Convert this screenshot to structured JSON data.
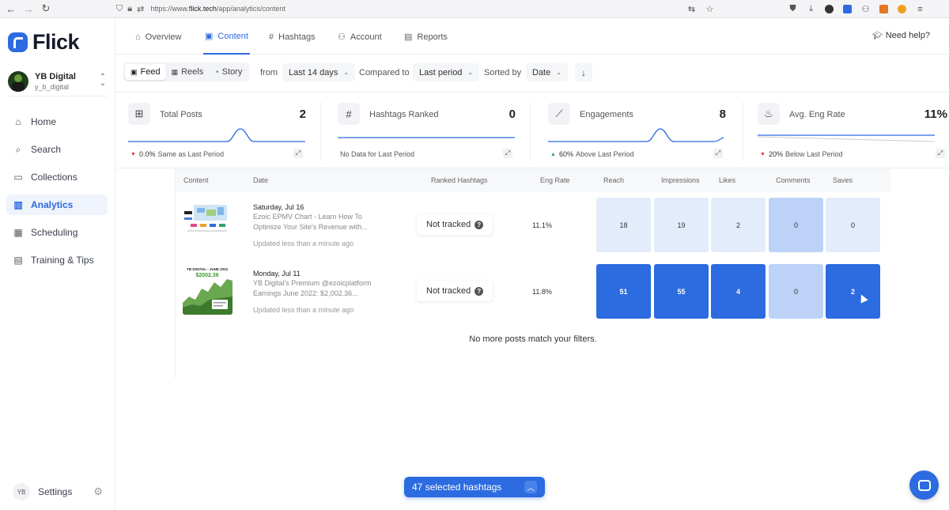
{
  "browser": {
    "url_prefix": "https://www.",
    "url_domain": "flick.tech",
    "url_path": "/app/analytics/content"
  },
  "sidebar": {
    "logo_text": "Flick",
    "account": {
      "name": "YB Digital",
      "handle": "y_b_digital"
    },
    "items": [
      {
        "label": "Home",
        "icon": "home-icon"
      },
      {
        "label": "Search",
        "icon": "search-icon"
      },
      {
        "label": "Collections",
        "icon": "folder-icon"
      },
      {
        "label": "Analytics",
        "icon": "chart-icon",
        "active": true
      },
      {
        "label": "Scheduling",
        "icon": "calendar-icon"
      },
      {
        "label": "Training & Tips",
        "icon": "book-icon"
      }
    ],
    "settings": {
      "initials": "YB",
      "label": "Settings"
    }
  },
  "tabs": [
    {
      "label": "Overview",
      "icon": "home-icon"
    },
    {
      "label": "Content",
      "icon": "content-icon",
      "active": true
    },
    {
      "label": "Hashtags",
      "icon": "hashtag-icon"
    },
    {
      "label": "Account",
      "icon": "people-icon"
    },
    {
      "label": "Reports",
      "icon": "document-icon"
    }
  ],
  "need_help": "Need help?",
  "filters": {
    "types": [
      "Feed",
      "Reels",
      "Story"
    ],
    "from_label": "from",
    "range": "Last 14 days",
    "compared_label": "Compared to",
    "compared": "Last period",
    "sorted_label": "Sorted by",
    "sorted": "Date"
  },
  "stats": [
    {
      "title": "Total Posts",
      "value": "2",
      "pct": "0.0%",
      "trend": "down",
      "foot": "Same as Last Period"
    },
    {
      "title": "Hashtags Ranked",
      "value": "0",
      "pct": "",
      "trend": "none",
      "foot": "No Data for Last Period"
    },
    {
      "title": "Engagements",
      "value": "8",
      "pct": "60%",
      "trend": "up",
      "foot": "Above Last Period"
    },
    {
      "title": "Avg. Eng Rate",
      "value": "11%",
      "pct": "20%",
      "trend": "down",
      "foot": "Below Last Period"
    }
  ],
  "table": {
    "headers": [
      "Content",
      "Date",
      "Ranked Hashtags",
      "Eng Rate",
      "Reach",
      "Impressions",
      "Likes",
      "Comments",
      "Saves"
    ],
    "rows": [
      {
        "date": "Saturday, Jul 16",
        "desc": "Ezoic EPMV Chart - Learn How To Optimize Your Site's Revenue with...",
        "updated": "Updated less than a minute ago",
        "hashtags": "Not tracked",
        "eng_rate": "11.1%",
        "reach": "18",
        "impressions": "19",
        "likes": "2",
        "comments": "0",
        "saves": "0"
      },
      {
        "date": "Monday, Jul 11",
        "desc": "YB Digital's Premium @ezoicplatform Earnings June 2022: $2,002.36...",
        "updated": "Updated less than a minute ago",
        "hashtags": "Not tracked",
        "eng_rate": "11.8%",
        "reach": "51",
        "impressions": "55",
        "likes": "4",
        "comments": "0",
        "saves": "2"
      }
    ],
    "empty_message": "No more posts match your filters."
  },
  "thumb2": {
    "title": "YB DIGITAL - JUNE 2022",
    "amount": "$2002.36"
  },
  "hashtag_pill": "47 selected hashtags",
  "colors": {
    "accent": "#2c6be0",
    "light_cell": "#e3ecfa",
    "mid_cell": "#bcd3f7"
  }
}
